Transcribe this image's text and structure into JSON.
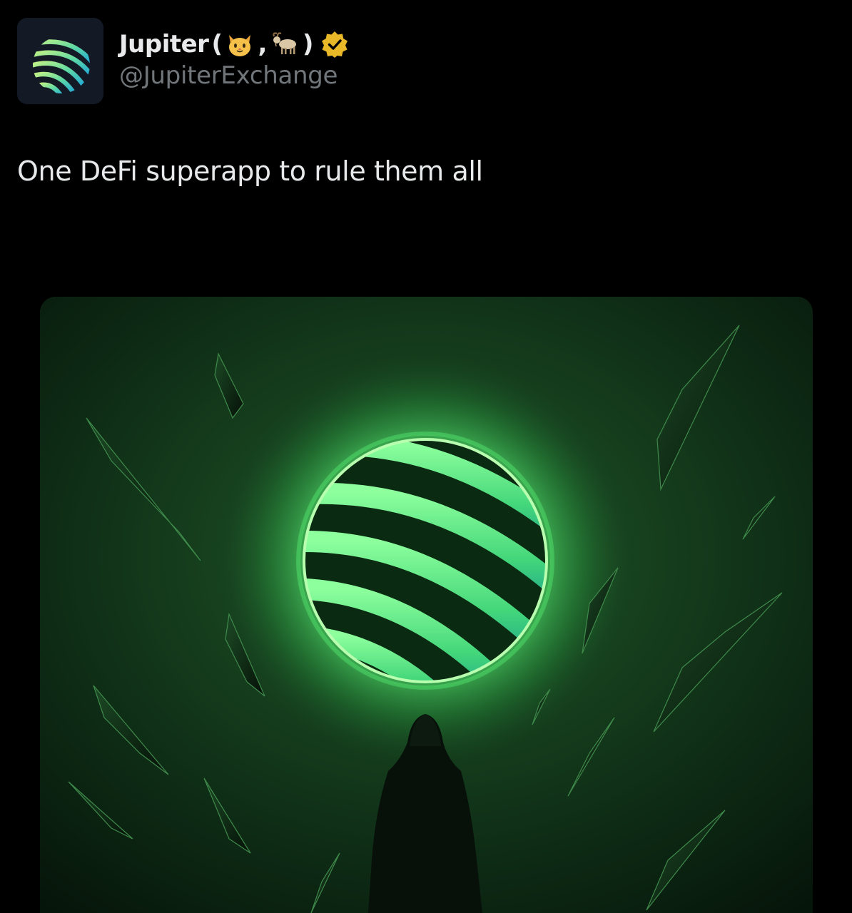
{
  "tweet": {
    "author": {
      "display_name": "Jupiter",
      "paren_open": "(",
      "separator": ",",
      "paren_close": ")",
      "name_emojis": [
        "cat-face-emoji",
        "goat-emoji"
      ],
      "handle": "@JupiterExchange",
      "verified": true,
      "verified_badge": "gold-verified-badge",
      "avatar_icon": "jupiter-logo"
    },
    "text": "One DeFi superapp to rule them all",
    "media": {
      "kind": "image",
      "subject": "glowing-green-jupiter-sphere",
      "icon": "jupiter-sphere-illustration"
    }
  },
  "colors": {
    "background": "#000000",
    "text_primary": "#e7e9ea",
    "text_secondary": "#71767b",
    "verified_gold": "#e8b829",
    "accent_green": "#7dff9a"
  }
}
